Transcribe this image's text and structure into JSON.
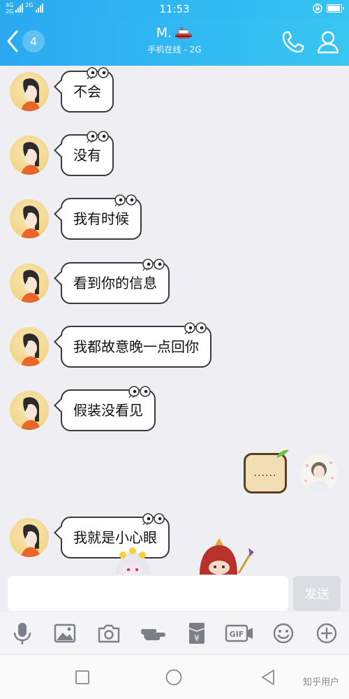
{
  "status_bar": {
    "network_top": "4G",
    "network_bottom": "2G",
    "network_extra": "2G",
    "time": "11:53"
  },
  "header": {
    "unread_count": "4",
    "title": "M.",
    "subtitle": "手机在线 - 2G"
  },
  "messages": [
    {
      "text": "不会"
    },
    {
      "text": "没有"
    },
    {
      "text": "我有时候"
    },
    {
      "text": "看到你的信息"
    },
    {
      "text": "我都故意晚一点回你"
    },
    {
      "text": "假装没看见"
    },
    {
      "self_text": "......"
    },
    {
      "text": "我就是小心眼"
    }
  ],
  "input": {
    "value": "",
    "send_label": "发送"
  },
  "toolbar": {
    "icons": [
      "microphone-icon",
      "image-icon",
      "camera-icon",
      "pointing-hand-icon",
      "red-packet-icon",
      "gif-icon",
      "emoji-icon",
      "plus-icon"
    ],
    "gif_label": "GIF",
    "red_packet_label": "¥"
  },
  "watermark": "知乎用户",
  "colors": {
    "header_start": "#2aa9f1",
    "header_end": "#38c6f2",
    "background": "#eeeef3",
    "icon_gray": "#7d7f88"
  }
}
